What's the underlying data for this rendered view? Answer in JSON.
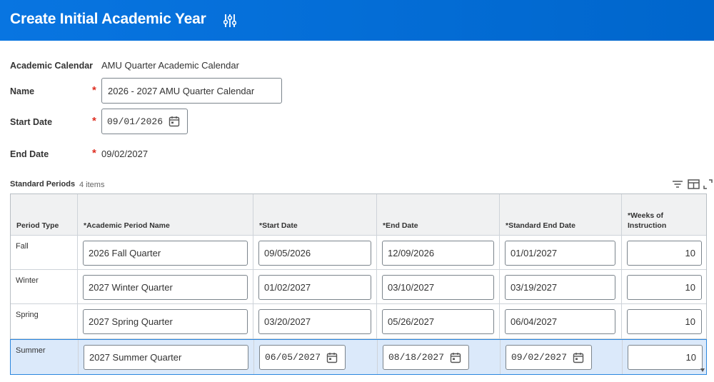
{
  "header": {
    "title": "Create Initial Academic Year",
    "icon": "sliders-icon",
    "color": "#0875e1"
  },
  "form": {
    "academic_calendar_label": "Academic Calendar",
    "academic_calendar_value": "AMU Quarter Academic Calendar",
    "name_label": "Name",
    "name_value": "2026 - 2027 AMU Quarter Calendar",
    "start_date_label": "Start Date",
    "start_date_value": "09/01/2026",
    "end_date_label": "End Date",
    "end_date_value": "09/02/2027",
    "required_marker": "*",
    "required_color": "#de2e21"
  },
  "periods": {
    "title": "Standard Periods",
    "count": "4 items",
    "columns": [
      "Period Type",
      "*Academic Period Name",
      "*Start Date",
      "*End Date",
      "*Standard End Date",
      "*Weeks of\nInstruction"
    ],
    "rows": [
      {
        "type": "Fall",
        "name": "2026 Fall Quarter",
        "start": "09/05/2026",
        "end": "12/09/2026",
        "std_end": "01/01/2027",
        "weeks": "10"
      },
      {
        "type": "Winter",
        "name": "2027 Winter Quarter",
        "start": "01/02/2027",
        "end": "03/10/2027",
        "std_end": "03/19/2027",
        "weeks": "10"
      },
      {
        "type": "Spring",
        "name": "2027 Spring Quarter",
        "start": "03/20/2027",
        "end": "05/26/2027",
        "std_end": "06/04/2027",
        "weeks": "10"
      },
      {
        "type": "Summer",
        "name": "2027 Summer Quarter",
        "start": "06/05/2027",
        "end": "08/18/2027",
        "std_end": "09/02/2027",
        "weeks": "10"
      }
    ]
  }
}
